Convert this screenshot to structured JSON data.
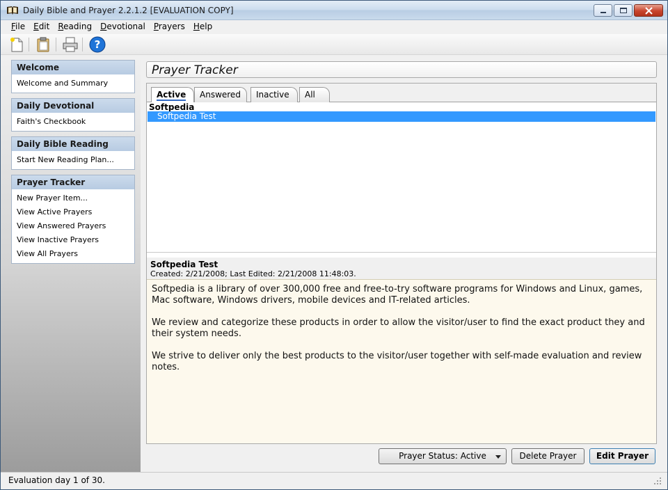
{
  "window": {
    "title": "Daily Bible and Prayer 2.2.1.2 [EVALUATION COPY]"
  },
  "menu": [
    {
      "label": "File",
      "accel": "F",
      "rest": "ile"
    },
    {
      "label": "Edit",
      "accel": "E",
      "rest": "dit"
    },
    {
      "label": "Reading",
      "accel": "R",
      "rest": "eading"
    },
    {
      "label": "Devotional",
      "accel": "D",
      "rest": "evotional"
    },
    {
      "label": "Prayers",
      "accel": "P",
      "rest": "rayers"
    },
    {
      "label": "Help",
      "accel": "H",
      "rest": "elp"
    }
  ],
  "toolbar": {
    "icons": [
      "new-document-icon",
      "paste-icon",
      "print-icon",
      "help-icon"
    ]
  },
  "sidebar": {
    "welcome": {
      "header": "Welcome",
      "items": [
        "Welcome and Summary"
      ]
    },
    "devotional": {
      "header": "Daily Devotional",
      "items": [
        "Faith's Checkbook"
      ]
    },
    "reading": {
      "header": "Daily Bible Reading",
      "items": [
        "Start New Reading Plan..."
      ]
    },
    "tracker": {
      "header": "Prayer Tracker",
      "items": [
        "New Prayer Item...",
        "View Active Prayers",
        "View Answered Prayers",
        "View Inactive Prayers",
        "View All Prayers"
      ]
    }
  },
  "main": {
    "title": "Prayer Tracker",
    "tabs": [
      "Active",
      "Answered",
      "Inactive",
      "All"
    ],
    "list": {
      "group": "Softpedia",
      "rows": [
        "Softpedia Test"
      ]
    },
    "detail": {
      "title": "Softpedia Test",
      "meta": "Created: 2/21/2008; Last Edited: 2/21/2008 11:48:03.",
      "paragraphs": [
        "Softpedia is a library of over 300,000 free and free-to-try software programs for Windows and Linux, games, Mac software, Windows drivers, mobile devices and IT-related articles.",
        "We review and categorize these products in order to allow the visitor/user to find the exact product they and their system needs.",
        "We strive to deliver only the best products to the visitor/user together with self-made evaluation and review notes."
      ]
    },
    "buttons": {
      "status": "Prayer Status: Active",
      "delete": "Delete Prayer",
      "edit": "Edit Prayer"
    }
  },
  "status": {
    "text": "Evaluation day 1 of 30."
  },
  "colors": {
    "selection": "#3399ff",
    "panel_header": "#c4d5ea",
    "detail_bg": "#fdf9ed"
  }
}
